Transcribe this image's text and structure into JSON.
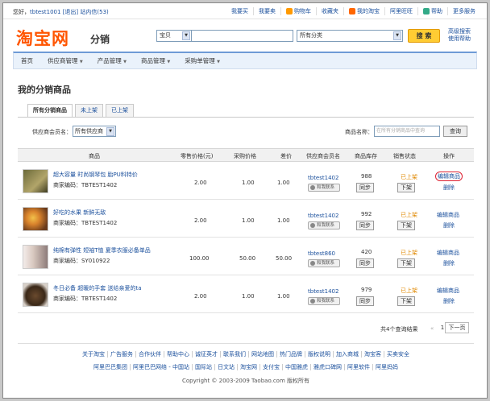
{
  "topbar": {
    "greeting": "您好，",
    "user": "tbtest1001",
    "logout": "[退出]",
    "messages": "站内信(53)",
    "links": [
      "我要买",
      "我要卖",
      "购物车",
      "收藏夹",
      "我的淘宝",
      "阿里旺旺",
      "帮助",
      "更多服务"
    ]
  },
  "header": {
    "logo": "淘宝网",
    "logo_sub": "分销",
    "search_scope": "宝贝",
    "search_value": "",
    "category": "所有分类",
    "search_button": "搜 索",
    "advanced": "高级搜索",
    "help": "使用帮助"
  },
  "nav": {
    "items": [
      "首页",
      "供应商管理",
      "产品管理",
      "商品管理",
      "采购单管理"
    ]
  },
  "page_title": "我的分销商品",
  "tabs": [
    "所有分销商品",
    "未上架",
    "已上架"
  ],
  "filter": {
    "supplier_label": "供应商会员名：",
    "supplier_value": "所有供应商",
    "product_label": "商品名称：",
    "product_placeholder": "在所有分销商品中查询",
    "query_button": "查询"
  },
  "table": {
    "headers": [
      "商品",
      "零售价格(元)",
      "采购价格",
      "差价",
      "供应商会员名",
      "商品库存",
      "销售状态",
      "操作"
    ],
    "rows": [
      {
        "name": "超大容量 时尚钢琴包 胎PU料特价",
        "code": "商家编码：TBTEST1402",
        "retail": "2.00",
        "purchase": "1.00",
        "diff": "1.00",
        "supplier": "tbtest1402",
        "wangwang": "和我联系",
        "stock": "988",
        "sync": "同步",
        "status": "已上架",
        "toggle": "下架",
        "edit": "编辑商品",
        "delete": "删除",
        "thumb": "#6b6a3a"
      },
      {
        "name": "好吃的水果 新鲜无敌",
        "code": "商家编码：TBTEST1402",
        "retail": "2.00",
        "purchase": "1.00",
        "diff": "1.00",
        "supplier": "tbtest1402",
        "wangwang": "和我联系",
        "stock": "992",
        "sync": "同步",
        "status": "已上架",
        "toggle": "下架",
        "edit": "编辑商品",
        "delete": "删除",
        "thumb": "#8a5a2a"
      },
      {
        "name": "纯棉有弹性 短袖T恤 夏季衣服必备单品",
        "code": "商家编码：SY010922",
        "retail": "100.00",
        "purchase": "50.00",
        "diff": "50.00",
        "supplier": "tbtest860",
        "wangwang": "和我联系",
        "stock": "420",
        "sync": "同步",
        "status": "已上架",
        "toggle": "下架",
        "edit": "编辑商品",
        "delete": "删除",
        "thumb": "#d9c9c0"
      },
      {
        "name": "冬日必备 超暖的手套 送给亲爱的ta",
        "code": "商家编码：TBTEST1402",
        "retail": "2.00",
        "purchase": "1.00",
        "diff": "1.00",
        "supplier": "tbtest1402",
        "wangwang": "和我联系",
        "stock": "979",
        "sync": "同步",
        "status": "已上架",
        "toggle": "下架",
        "edit": "编辑商品",
        "delete": "删除",
        "thumb": "#4a3a2a"
      }
    ]
  },
  "pager": {
    "total": "共4个查询结果",
    "current": "1",
    "next": "下一页"
  },
  "footer": {
    "links": [
      "关于淘宝",
      "广告服务",
      "合作伙伴",
      "帮助中心",
      "诚征英才",
      "联系我们",
      "网站地图",
      "热门品牌",
      "版权说明",
      "加入商城",
      "淘宝客",
      "买卖安全"
    ],
    "links2": [
      "阿里巴巴集团",
      "阿里巴巴网络 - 中国站",
      "国际站",
      "日文站",
      "淘宝网",
      "支付宝",
      "中国雅虎",
      "雅虎口碑网",
      "阿里软件",
      "阿里妈妈"
    ],
    "copyright": "Copyright © 2003-2009 Taobao.com 版权所有"
  },
  "colors": {
    "brand": "#ff5500",
    "link": "#1a4f9c",
    "status": "#e08800",
    "nav_border": "#6e9bd6"
  }
}
